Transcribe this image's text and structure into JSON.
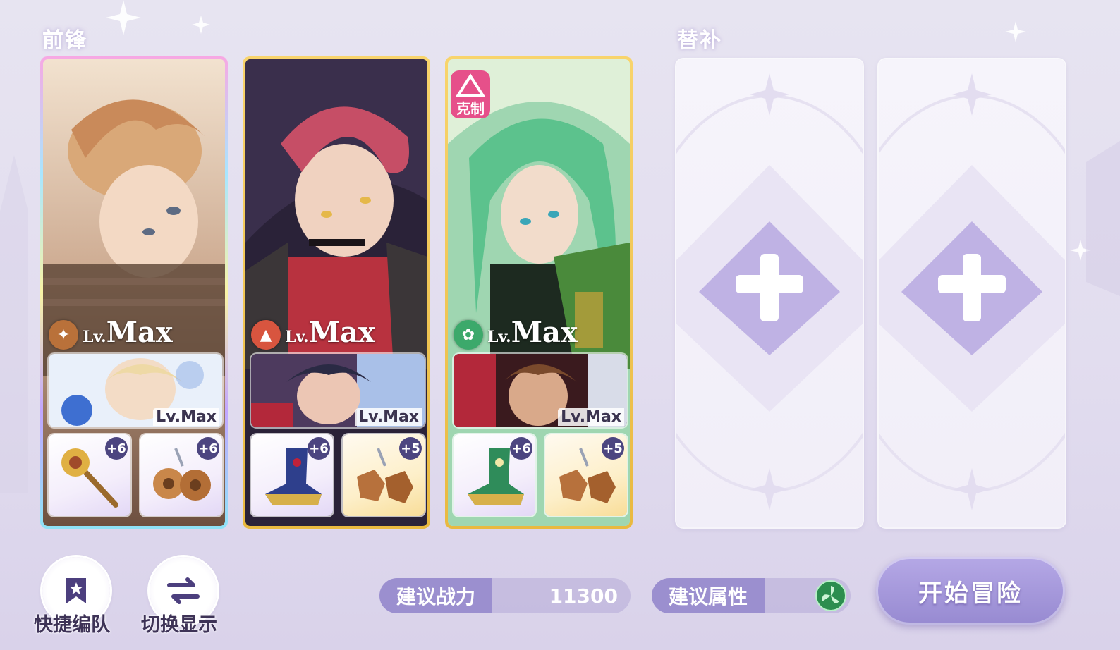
{
  "sections": {
    "front": "前锋",
    "sub": "替补"
  },
  "cards": [
    {
      "level_prefix": "Lv.",
      "level_value": "Max",
      "element_icon": "gold-element-icon",
      "element_color": "#b9713a",
      "partner_level": "Lv.Max",
      "gear": [
        {
          "plus": "+6",
          "icon": "scepter-icon"
        },
        {
          "plus": "+6",
          "icon": "earrings-icon"
        }
      ]
    },
    {
      "level_prefix": "Lv.",
      "level_value": "Max",
      "element_icon": "fire-element-icon",
      "element_color": "#d8553f",
      "partner_level": "Lv.Max",
      "gear": [
        {
          "plus": "+6",
          "icon": "boot-icon"
        },
        {
          "plus": "+5",
          "icon": "earrings-icon"
        }
      ]
    },
    {
      "counter_label": "克制",
      "level_prefix": "Lv.",
      "level_value": "Max",
      "element_icon": "wind-element-icon",
      "element_color": "#3ca96b",
      "partner_level": "Lv.Max",
      "gear": [
        {
          "plus": "+6",
          "icon": "boot-icon"
        },
        {
          "plus": "+5",
          "icon": "earrings-icon"
        }
      ]
    }
  ],
  "buttons": {
    "quick_team": "快捷编队",
    "toggle_display": "切换显示",
    "start": "开始冒险"
  },
  "recommend": {
    "power_label": "建议战力",
    "power_value": "11300",
    "attr_label": "建议属性",
    "attr_icon": "wind-element-icon"
  },
  "colors": {
    "accent": "#9b8fcf",
    "gold_frame": "#f0c454",
    "counter_badge": "#e6508a"
  }
}
